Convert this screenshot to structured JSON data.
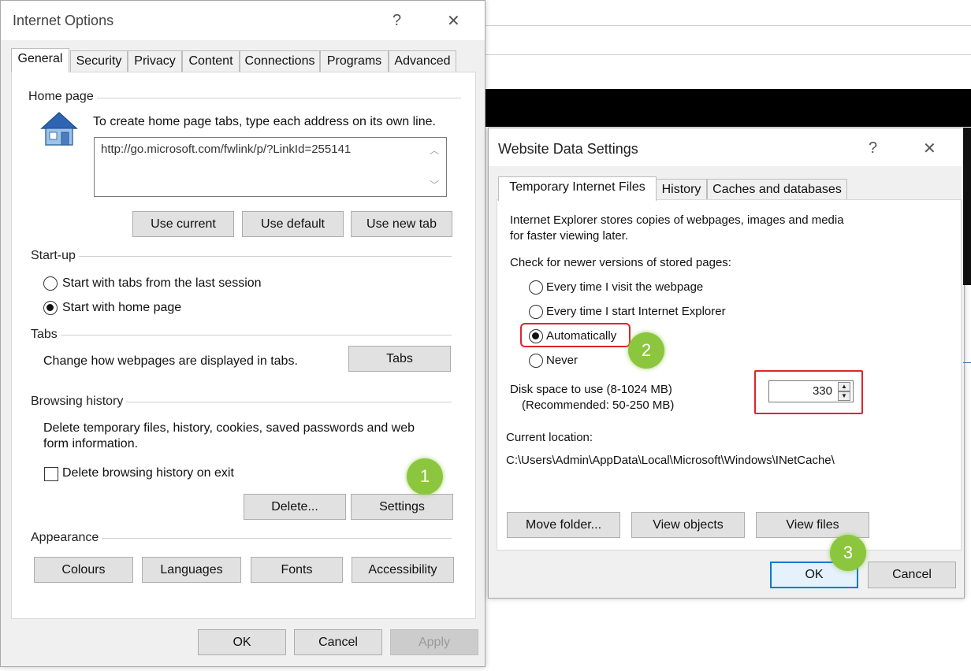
{
  "internet_options": {
    "title": "Internet Options",
    "help": "?",
    "close": "✕",
    "tabs": [
      "General",
      "Security",
      "Privacy",
      "Content",
      "Connections",
      "Programs",
      "Advanced"
    ],
    "home_page": {
      "label": "Home page",
      "instruction": "To create home page tabs, type each address on its own line.",
      "url": "http://go.microsoft.com/fwlink/p/?LinkId=255141",
      "buttons": {
        "use_current": "Use current",
        "use_default": "Use default",
        "use_new_tab": "Use new tab"
      }
    },
    "startup": {
      "label": "Start-up",
      "option_tabs": "Start with tabs from the last session",
      "option_home": "Start with home page",
      "selected": "home"
    },
    "tabs_section": {
      "label": "Tabs",
      "description": "Change how webpages are displayed in tabs.",
      "button": "Tabs"
    },
    "browsing_history": {
      "label": "Browsing history",
      "description_line1": "Delete temporary files, history, cookies, saved passwords and web",
      "description_line2": "form information.",
      "delete_on_exit": "Delete browsing history on exit",
      "delete_button": "Delete...",
      "settings_button": "Settings"
    },
    "appearance": {
      "label": "Appearance",
      "buttons": {
        "colours": "Colours",
        "languages": "Languages",
        "fonts": "Fonts",
        "accessibility": "Accessibility"
      }
    },
    "footer": {
      "ok": "OK",
      "cancel": "Cancel",
      "apply": "Apply"
    }
  },
  "website_data": {
    "title": "Website Data Settings",
    "help": "?",
    "close": "✕",
    "tabs": [
      "Temporary Internet Files",
      "History",
      "Caches and databases"
    ],
    "intro_line1": "Internet Explorer stores copies of webpages, images and media",
    "intro_line2": "for faster viewing later.",
    "check_label": "Check for newer versions of stored pages:",
    "options": [
      "Every time I visit the webpage",
      "Every time I start Internet Explorer",
      "Automatically",
      "Never"
    ],
    "selected_option": "Automatically",
    "disk_line1": "Disk space to use (8-1024 MB)",
    "disk_line2": "(Recommended: 50-250 MB)",
    "disk_value": "330",
    "current_location_label": "Current location:",
    "current_location_path": "C:\\Users\\Admin\\AppData\\Local\\Microsoft\\Windows\\INetCache\\",
    "buttons": {
      "move_folder": "Move folder...",
      "view_objects": "View objects",
      "view_files": "View files"
    },
    "footer": {
      "ok": "OK",
      "cancel": "Cancel"
    }
  },
  "annotations": {
    "step1": "1",
    "step2": "2",
    "step3": "3",
    "highlight_color": "#e0242b",
    "badge_color": "#8cc63f"
  }
}
